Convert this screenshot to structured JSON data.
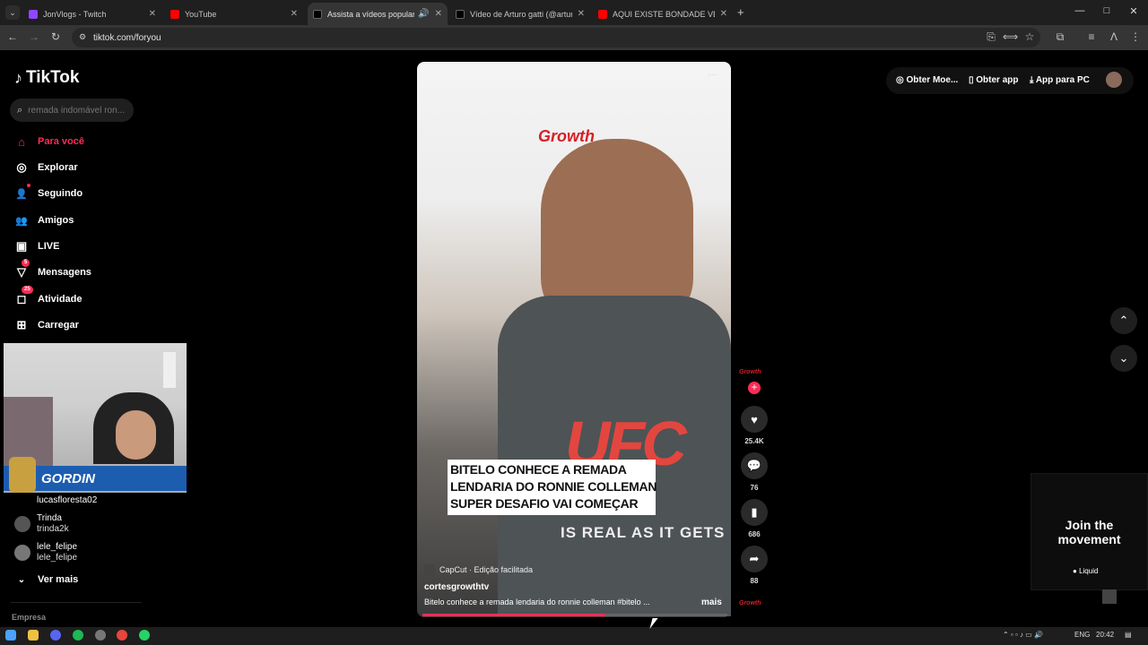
{
  "browser": {
    "tabs": [
      {
        "label": "JonVlogs - Twitch",
        "favicon_color": "#9146ff",
        "close": "✕"
      },
      {
        "label": "YouTube",
        "favicon_color": "#ff0000",
        "close": "✕"
      },
      {
        "label": "Assista a vídeos populares",
        "favicon_color": "#000000",
        "close": "✕"
      },
      {
        "label": "Vídeo de Arturo gatti (@arturo_",
        "favicon_color": "#000000",
        "close": "✕"
      },
      {
        "label": "AQUI EXISTE BONDADE VERDA",
        "favicon_color": "#ff0000",
        "close": "✕"
      }
    ],
    "new_tab": "+",
    "url": "tiktok.com/foryou",
    "window_controls": {
      "minimize": "—",
      "maximize": "□",
      "close": "✕"
    }
  },
  "sidebar": {
    "logo": "TikTok",
    "search_placeholder": "remada indomável ron...",
    "nav": [
      {
        "label": "Para você",
        "icon": "home-icon",
        "glyph": "⌂",
        "active": true
      },
      {
        "label": "Explorar",
        "icon": "compass-icon",
        "glyph": "◎",
        "active": false
      },
      {
        "label": "Seguindo",
        "icon": "following-icon",
        "glyph": "👤",
        "active": false
      },
      {
        "label": "Amigos",
        "icon": "friends-icon",
        "glyph": "👥",
        "active": false
      },
      {
        "label": "LIVE",
        "icon": "live-icon",
        "glyph": "▣",
        "active": false
      },
      {
        "label": "Mensagens",
        "icon": "messages-icon",
        "glyph": "▽",
        "badge": "5",
        "active": false
      },
      {
        "label": "Atividade",
        "icon": "activity-icon",
        "glyph": "◻",
        "badge": "25",
        "active": false
      },
      {
        "label": "Carregar",
        "icon": "upload-icon",
        "glyph": "⊞",
        "active": false
      }
    ],
    "webcam_overlay_name": "GORDIN",
    "following": [
      {
        "name": "lucasfloresta02",
        "user": ""
      },
      {
        "name": "Trinda",
        "user": "trinda2k"
      },
      {
        "name": "lele_felipe",
        "user": "lele_felipe"
      }
    ],
    "see_more": "Ver mais",
    "footer": "Empresa"
  },
  "video": {
    "brand_overlay": "Growth",
    "shirt_logo": "UFC",
    "shirt_text": "IS REAL AS IT GETS",
    "caption_lines": [
      "BITELO CONHECE A REMADA",
      "LENDARIA DO RONNIE COLLEMAN",
      "SUPER DESAFIO VAI COMEÇAR"
    ],
    "capcut": "CapCut · Edição facilitada",
    "author": "cortesgrowthtv",
    "description": "Bitelo conhece a remada lendaria do ronnie colleman #bitelo ...",
    "more": "mais",
    "progress": 0.6,
    "progress_color": "#fe2c55"
  },
  "actions": {
    "likes": "25.4K",
    "comments": "76",
    "saves": "686",
    "shares": "88"
  },
  "top_right": {
    "coins": "Obter Moe...",
    "get_app": "Obter app",
    "pc_app": "App para PC"
  },
  "ad": {
    "title_line1": "Join the",
    "title_line2": "movement",
    "brand": "Liquid"
  },
  "taskbar": {
    "lang": "ENG",
    "time": "20:42"
  },
  "colors": {
    "accent": "#fe2c55",
    "background": "#000000"
  }
}
